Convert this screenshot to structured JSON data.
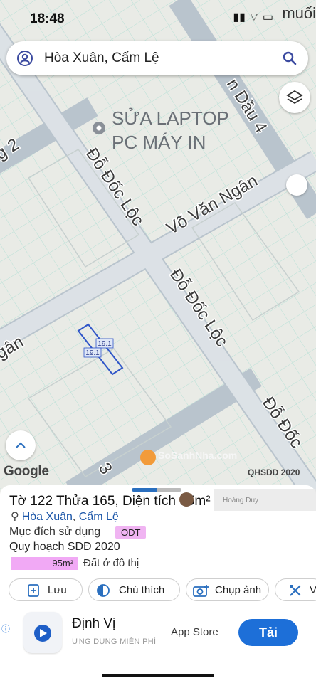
{
  "status_bar": {
    "time": "18:48",
    "signal_icons": "▮▮ ⌔ ▭",
    "tail_text": "muối"
  },
  "search": {
    "value": "Hòa Xuân, Cẩm Lệ"
  },
  "map": {
    "streets": [
      "Đỗ Đốc Lộc",
      "Võ Văn Ngân",
      "Đỗ Đốc Lộc",
      "Đỗ Đốc",
      "n Dầu 4",
      "g 2",
      "gân",
      "3"
    ],
    "poi": "SỬA LAPTOP\nPC MÁY IN",
    "parcel_labels": [
      "19.1",
      "19.1"
    ],
    "attribution": "Google",
    "overlay_label": "QHSDD 2020",
    "watermark": "SoSanhNha.com"
  },
  "sheet": {
    "title_prefix": "Tờ 122 Thửa 165, Diện tích ",
    "title_area": "95m²",
    "watermark_name": "Hoàng Duy",
    "ward_link": "Hòa Xuân",
    "district_link": "Cẩm Lệ",
    "purpose_label": "Mục đích sử dụng",
    "purpose_code": "ODT",
    "plan_label": "Quy hoạch SDĐ 2020",
    "plan_area": "95m²",
    "plan_type": "Đất ở đô thị",
    "chips": [
      {
        "label": "Lưu",
        "icon": "add-note-icon"
      },
      {
        "label": "Chú thích",
        "icon": "half-circle-icon"
      },
      {
        "label": "Chụp ảnh",
        "icon": "camera-icon"
      },
      {
        "label": "Vẽ",
        "icon": "draw-icon"
      }
    ],
    "ad": {
      "app_name": "Định Vị",
      "app_sub": "ƯNG DỤNG MIỄN PHÍ",
      "store": "App Store",
      "cta": "Tải"
    }
  },
  "colors": {
    "accent": "#1d6fd8",
    "land_pink": "#f1a9f5",
    "road": "#b9c4cd",
    "map_bg": "#e9ebe6"
  }
}
